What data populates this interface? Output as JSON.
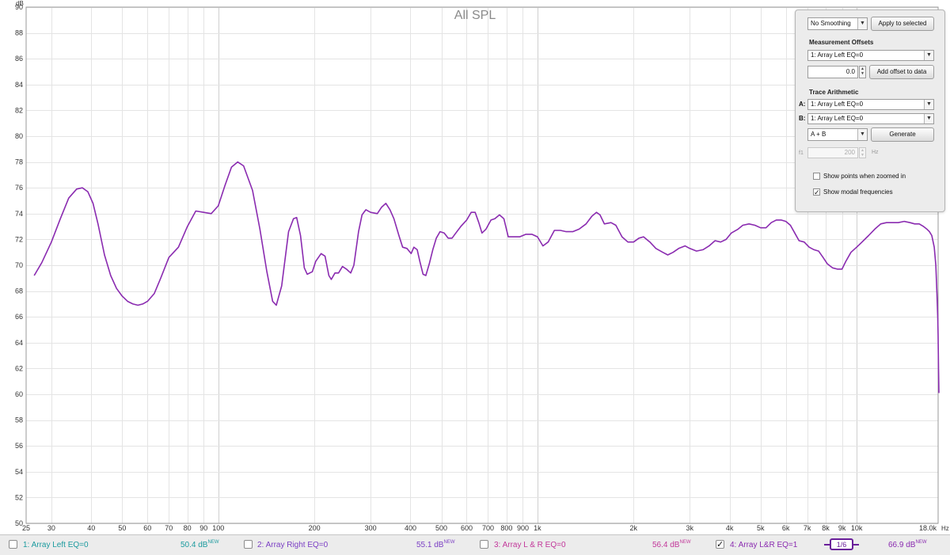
{
  "chart_data": {
    "type": "line",
    "title": "All SPL",
    "ylabel": "dB",
    "xlabel": "Hz",
    "x_scale": "log",
    "xlim": [
      25,
      18000
    ],
    "ylim": [
      50,
      90
    ],
    "grid": true,
    "x_ticks": [
      {
        "value": 25,
        "label": "25"
      },
      {
        "value": 30,
        "label": "30"
      },
      {
        "value": 40,
        "label": "40"
      },
      {
        "value": 50,
        "label": "50"
      },
      {
        "value": 60,
        "label": "60"
      },
      {
        "value": 70,
        "label": "70"
      },
      {
        "value": 80,
        "label": "80"
      },
      {
        "value": 90,
        "label": "90"
      },
      {
        "value": 100,
        "label": "100"
      },
      {
        "value": 200,
        "label": "200"
      },
      {
        "value": 300,
        "label": "300"
      },
      {
        "value": 400,
        "label": "400"
      },
      {
        "value": 500,
        "label": "500"
      },
      {
        "value": 600,
        "label": "600"
      },
      {
        "value": 700,
        "label": "700"
      },
      {
        "value": 800,
        "label": "800"
      },
      {
        "value": 900,
        "label": "900"
      },
      {
        "value": 1000,
        "label": "1k"
      },
      {
        "value": 2000,
        "label": "2k"
      },
      {
        "value": 3000,
        "label": "3k"
      },
      {
        "value": 4000,
        "label": "4k"
      },
      {
        "value": 5000,
        "label": "5k"
      },
      {
        "value": 6000,
        "label": "6k"
      },
      {
        "value": 7000,
        "label": "7k"
      },
      {
        "value": 8000,
        "label": "8k"
      },
      {
        "value": 9000,
        "label": "9k"
      },
      {
        "value": 10000,
        "label": "10k"
      },
      {
        "value": 18000,
        "label": "18.0k"
      }
    ],
    "y_ticks": [
      50,
      52,
      54,
      56,
      58,
      60,
      62,
      64,
      66,
      68,
      70,
      72,
      74,
      76,
      78,
      80,
      82,
      84,
      86,
      88,
      90
    ],
    "series": [
      {
        "name": "4: Array L&R EQ=1",
        "color": "#8a2bb0",
        "points": [
          [
            26.5,
            69.2
          ],
          [
            28,
            70.2
          ],
          [
            30,
            71.8
          ],
          [
            32,
            73.6
          ],
          [
            34,
            75.2
          ],
          [
            36,
            75.9
          ],
          [
            37.5,
            76.0
          ],
          [
            39,
            75.7
          ],
          [
            40.5,
            74.8
          ],
          [
            42,
            73.2
          ],
          [
            44,
            70.8
          ],
          [
            46,
            69.2
          ],
          [
            48,
            68.2
          ],
          [
            50,
            67.6
          ],
          [
            52,
            67.2
          ],
          [
            54,
            67.0
          ],
          [
            56,
            66.9
          ],
          [
            58,
            67.0
          ],
          [
            60,
            67.2
          ],
          [
            63,
            67.8
          ],
          [
            66,
            69.0
          ],
          [
            70,
            70.6
          ],
          [
            75,
            71.4
          ],
          [
            80,
            73.0
          ],
          [
            85,
            74.2
          ],
          [
            90,
            74.1
          ],
          [
            95,
            74.0
          ],
          [
            100,
            74.6
          ],
          [
            105,
            76.2
          ],
          [
            110,
            77.6
          ],
          [
            115,
            78.0
          ],
          [
            120,
            77.7
          ],
          [
            128,
            75.8
          ],
          [
            135,
            72.8
          ],
          [
            142,
            69.5
          ],
          [
            148,
            67.2
          ],
          [
            152,
            66.9
          ],
          [
            158,
            68.4
          ],
          [
            166,
            72.6
          ],
          [
            172,
            73.6
          ],
          [
            176,
            73.7
          ],
          [
            181,
            72.3
          ],
          [
            186,
            69.8
          ],
          [
            190,
            69.3
          ],
          [
            197,
            69.5
          ],
          [
            202,
            70.3
          ],
          [
            210,
            70.9
          ],
          [
            216,
            70.7
          ],
          [
            222,
            69.2
          ],
          [
            226,
            68.9
          ],
          [
            232,
            69.4
          ],
          [
            238,
            69.4
          ],
          [
            245,
            69.9
          ],
          [
            252,
            69.7
          ],
          [
            260,
            69.4
          ],
          [
            266,
            70.0
          ],
          [
            275,
            72.6
          ],
          [
            282,
            73.9
          ],
          [
            290,
            74.3
          ],
          [
            300,
            74.1
          ],
          [
            315,
            74.0
          ],
          [
            325,
            74.5
          ],
          [
            335,
            74.8
          ],
          [
            345,
            74.3
          ],
          [
            355,
            73.6
          ],
          [
            368,
            72.3
          ],
          [
            378,
            71.4
          ],
          [
            390,
            71.3
          ],
          [
            402,
            70.9
          ],
          [
            410,
            71.4
          ],
          [
            420,
            71.2
          ],
          [
            428,
            70.3
          ],
          [
            438,
            69.3
          ],
          [
            447,
            69.2
          ],
          [
            458,
            70.1
          ],
          [
            470,
            71.2
          ],
          [
            482,
            72.1
          ],
          [
            495,
            72.6
          ],
          [
            510,
            72.5
          ],
          [
            525,
            72.1
          ],
          [
            540,
            72.1
          ],
          [
            555,
            72.5
          ],
          [
            575,
            73.0
          ],
          [
            600,
            73.5
          ],
          [
            620,
            74.1
          ],
          [
            638,
            74.1
          ],
          [
            655,
            73.3
          ],
          [
            670,
            72.5
          ],
          [
            690,
            72.8
          ],
          [
            715,
            73.5
          ],
          [
            735,
            73.6
          ],
          [
            760,
            73.9
          ],
          [
            785,
            73.6
          ],
          [
            810,
            72.2
          ],
          [
            845,
            72.2
          ],
          [
            880,
            72.2
          ],
          [
            920,
            72.4
          ],
          [
            960,
            72.4
          ],
          [
            1000,
            72.2
          ],
          [
            1040,
            71.5
          ],
          [
            1080,
            71.8
          ],
          [
            1130,
            72.7
          ],
          [
            1180,
            72.7
          ],
          [
            1230,
            72.6
          ],
          [
            1290,
            72.6
          ],
          [
            1350,
            72.8
          ],
          [
            1420,
            73.2
          ],
          [
            1480,
            73.8
          ],
          [
            1530,
            74.1
          ],
          [
            1570,
            73.9
          ],
          [
            1620,
            73.2
          ],
          [
            1700,
            73.3
          ],
          [
            1760,
            73.1
          ],
          [
            1840,
            72.2
          ],
          [
            1920,
            71.8
          ],
          [
            2000,
            71.8
          ],
          [
            2080,
            72.1
          ],
          [
            2150,
            72.2
          ],
          [
            2250,
            71.8
          ],
          [
            2350,
            71.3
          ],
          [
            2470,
            71.0
          ],
          [
            2560,
            70.8
          ],
          [
            2660,
            71.0
          ],
          [
            2770,
            71.3
          ],
          [
            2900,
            71.5
          ],
          [
            3000,
            71.3
          ],
          [
            3150,
            71.1
          ],
          [
            3300,
            71.2
          ],
          [
            3450,
            71.5
          ],
          [
            3600,
            71.9
          ],
          [
            3750,
            71.8
          ],
          [
            3900,
            72.0
          ],
          [
            4050,
            72.5
          ],
          [
            4250,
            72.8
          ],
          [
            4400,
            73.1
          ],
          [
            4600,
            73.2
          ],
          [
            4800,
            73.1
          ],
          [
            5000,
            72.9
          ],
          [
            5200,
            72.9
          ],
          [
            5400,
            73.3
          ],
          [
            5600,
            73.5
          ],
          [
            5800,
            73.5
          ],
          [
            6000,
            73.4
          ],
          [
            6200,
            73.1
          ],
          [
            6400,
            72.5
          ],
          [
            6600,
            71.9
          ],
          [
            6850,
            71.8
          ],
          [
            7100,
            71.4
          ],
          [
            7350,
            71.2
          ],
          [
            7600,
            71.1
          ],
          [
            7850,
            70.6
          ],
          [
            8100,
            70.1
          ],
          [
            8400,
            69.8
          ],
          [
            8700,
            69.7
          ],
          [
            9000,
            69.7
          ],
          [
            9250,
            70.3
          ],
          [
            9600,
            71.0
          ],
          [
            10000,
            71.4
          ],
          [
            10400,
            71.8
          ],
          [
            10900,
            72.3
          ],
          [
            11400,
            72.8
          ],
          [
            11900,
            73.2
          ],
          [
            12400,
            73.3
          ],
          [
            13000,
            73.3
          ],
          [
            13500,
            73.3
          ],
          [
            14100,
            73.4
          ],
          [
            14700,
            73.3
          ],
          [
            15200,
            73.2
          ],
          [
            15700,
            73.2
          ],
          [
            16200,
            73.0
          ],
          [
            16600,
            72.8
          ],
          [
            16900,
            72.6
          ],
          [
            17200,
            72.3
          ],
          [
            17500,
            71.4
          ],
          [
            17700,
            70.0
          ],
          [
            17850,
            67.8
          ],
          [
            17950,
            66.0
          ],
          [
            18000,
            64.5
          ],
          [
            18050,
            62.0
          ],
          [
            18100,
            60.1
          ]
        ]
      }
    ]
  },
  "panel": {
    "smoothing": "No Smoothing",
    "apply_button": "Apply to selected",
    "offsets_title": "Measurement Offsets",
    "offset_measurement": "1: Array Left EQ=0",
    "offset_value": "0.0",
    "add_offset_button": "Add offset to data",
    "arith_title": "Trace Arithmetic",
    "a_label": "A:",
    "a_value": "1: Array Left EQ=0",
    "b_label": "B:",
    "b_value": "1: Array Left EQ=0",
    "operation": "A + B",
    "generate_button": "Generate",
    "f1_label": "f1",
    "f1_value": "200",
    "f1_unit": "Hz",
    "show_points_label": "Show points when zoomed in",
    "show_points_checked": false,
    "show_modal_label": "Show modal frequencies",
    "show_modal_checked": true
  },
  "legend": {
    "items": [
      {
        "name": "1: Array Left EQ=0",
        "value": "50.4 dB",
        "tag": "NEW",
        "checked": false,
        "color": "#1b9a9e"
      },
      {
        "name": "2: Array Right EQ=0",
        "value": "55.1 dB",
        "tag": "NEW",
        "checked": false,
        "color": "#7b3fc4"
      },
      {
        "name": "3: Array L & R EQ=0",
        "value": "56.4 dB",
        "tag": "NEW",
        "checked": false,
        "color": "#c2379a"
      },
      {
        "name": "4: Array L&R EQ=1",
        "value": "66.9 dB",
        "tag": "NEW",
        "checked": true,
        "color": "#8a2bb0"
      }
    ],
    "pager_current": "1",
    "pager_total": "6"
  }
}
